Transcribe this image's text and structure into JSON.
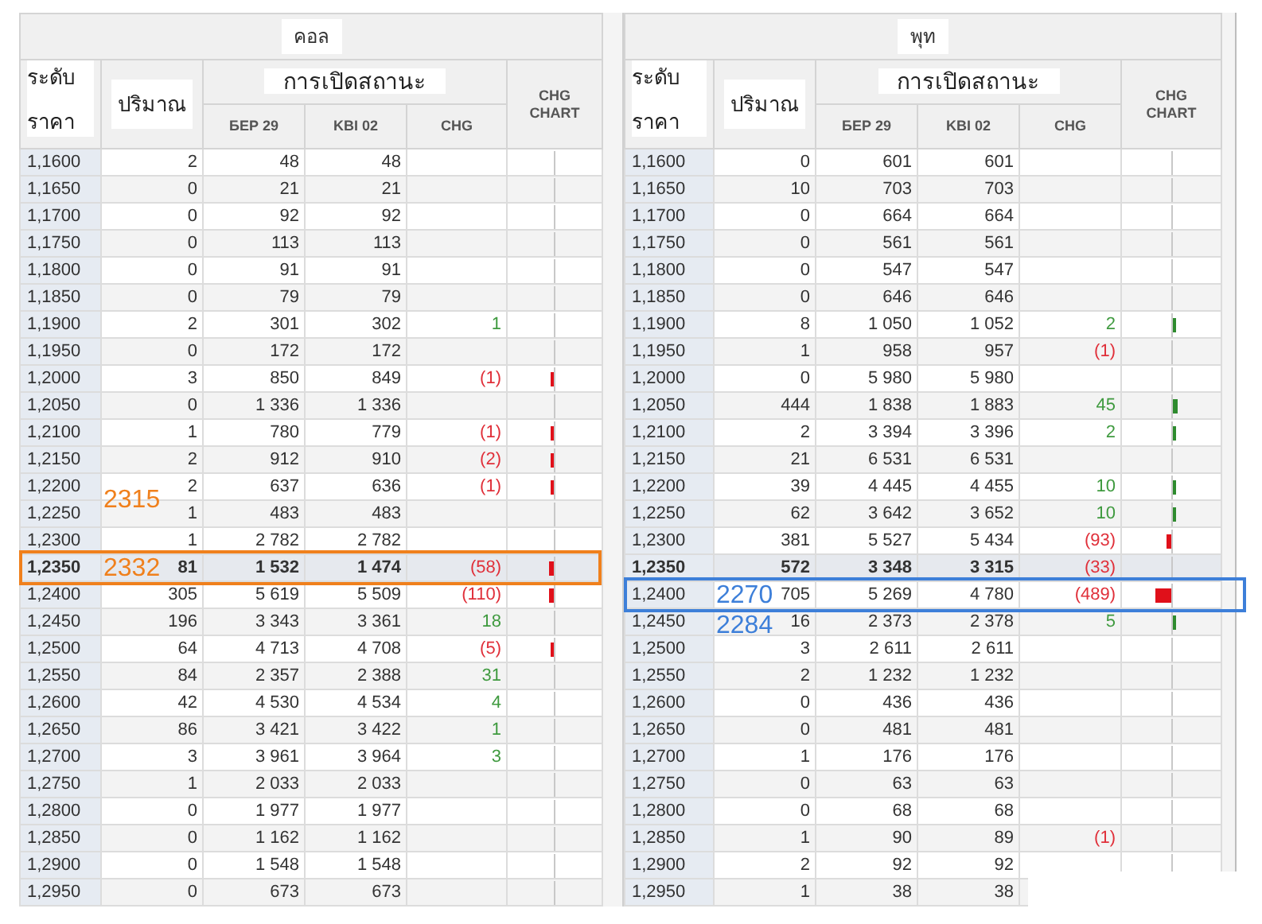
{
  "tables": [
    {
      "title": "คอล",
      "headers": {
        "price": [
          "ระดับ",
          "ราคา"
        ],
        "volume": "ปริมาณ",
        "open_interest": "การเปิดสถานะ",
        "columns": [
          "БЕР 29",
          "KBI 02",
          "CHG"
        ],
        "chart": [
          "CHG",
          "CHART"
        ]
      },
      "color": "#f0801c",
      "rows": [
        {
          "price": "1,1600",
          "volume": "2",
          "bep": "48",
          "kbi": "48",
          "selected": false,
          "boxed": false
        },
        {
          "price": "1,1650",
          "volume": "0",
          "bep": "21",
          "kbi": "21",
          "selected": false,
          "boxed": false
        },
        {
          "price": "1,1700",
          "volume": "0",
          "bep": "92",
          "kbi": "92",
          "selected": false,
          "boxed": false
        },
        {
          "price": "1,1750",
          "volume": "0",
          "bep": "113",
          "kbi": "113",
          "selected": false,
          "boxed": false
        },
        {
          "price": "1,1800",
          "volume": "0",
          "bep": "91",
          "kbi": "91",
          "selected": false,
          "boxed": false
        },
        {
          "price": "1,1850",
          "volume": "0",
          "bep": "79",
          "kbi": "79",
          "selected": false,
          "boxed": false
        },
        {
          "price": "1,1900",
          "volume": "2",
          "bep": "301",
          "kbi": "302",
          "chg": "1",
          "kind": "up",
          "selected": false,
          "boxed": false
        },
        {
          "price": "1,1950",
          "volume": "0",
          "bep": "172",
          "kbi": "172",
          "selected": false,
          "boxed": false
        },
        {
          "price": "1,2000",
          "volume": "3",
          "bep": "850",
          "kbi": "849",
          "chg": "(1)",
          "kind": "down",
          "bar": {
            "level": 0.07
          },
          "selected": false,
          "boxed": false
        },
        {
          "price": "1,2050",
          "volume": "0",
          "bep": "1 336",
          "kbi": "1 336",
          "selected": false,
          "boxed": false
        },
        {
          "price": "1,2100",
          "volume": "1",
          "bep": "780",
          "kbi": "779",
          "chg": "(1)",
          "kind": "down",
          "bar": {
            "level": 0.07
          },
          "selected": false,
          "boxed": false
        },
        {
          "price": "1,2150",
          "volume": "2",
          "bep": "912",
          "kbi": "910",
          "chg": "(2)",
          "kind": "down",
          "bar": {
            "level": 0.07
          },
          "selected": false,
          "boxed": false
        },
        {
          "price": "1,2200",
          "volume": "2",
          "bep": "637",
          "kbi": "636",
          "chg": "(1)",
          "kind": "down",
          "bar": {
            "level": 0.07
          },
          "note": "2315",
          "selected": false,
          "boxed": false
        },
        {
          "price": "1,2250",
          "volume": "1",
          "bep": "483",
          "kbi": "483",
          "selected": false,
          "boxed": false
        },
        {
          "price": "1,2300",
          "volume": "1",
          "bep": "2 782",
          "kbi": "2 782",
          "selected": false,
          "boxed": false
        },
        {
          "price": "1,2350",
          "volume": "81",
          "bep": "1 532",
          "kbi": "1 474",
          "chg": "(58)",
          "kind": "down",
          "bar": {
            "level": 0.1
          },
          "note": "2332",
          "selected": true,
          "boxed": true
        },
        {
          "price": "1,2400",
          "volume": "305",
          "bep": "5 619",
          "kbi": "5 509",
          "chg": "(110)",
          "kind": "down",
          "bar": {
            "level": 0.1
          },
          "selected": false,
          "boxed": false
        },
        {
          "price": "1,2450",
          "volume": "196",
          "bep": "3 343",
          "kbi": "3 361",
          "chg": "18",
          "kind": "up",
          "selected": false,
          "boxed": false
        },
        {
          "price": "1,2500",
          "volume": "64",
          "bep": "4 713",
          "kbi": "4 708",
          "chg": "(5)",
          "kind": "down",
          "bar": {
            "level": 0.07
          },
          "selected": false,
          "boxed": false
        },
        {
          "price": "1,2550",
          "volume": "84",
          "bep": "2 357",
          "kbi": "2 388",
          "chg": "31",
          "kind": "up",
          "selected": false,
          "boxed": false
        },
        {
          "price": "1,2600",
          "volume": "42",
          "bep": "4 530",
          "kbi": "4 534",
          "chg": "4",
          "kind": "up",
          "selected": false,
          "boxed": false
        },
        {
          "price": "1,2650",
          "volume": "86",
          "bep": "3 421",
          "kbi": "3 422",
          "chg": "1",
          "kind": "up",
          "selected": false,
          "boxed": false
        },
        {
          "price": "1,2700",
          "volume": "3",
          "bep": "3 961",
          "kbi": "3 964",
          "chg": "3",
          "kind": "up",
          "selected": false,
          "boxed": false
        },
        {
          "price": "1,2750",
          "volume": "1",
          "bep": "2 033",
          "kbi": "2 033",
          "selected": false,
          "boxed": false
        },
        {
          "price": "1,2800",
          "volume": "0",
          "bep": "1 977",
          "kbi": "1 977",
          "selected": false,
          "boxed": false
        },
        {
          "price": "1,2850",
          "volume": "0",
          "bep": "1 162",
          "kbi": "1 162",
          "selected": false,
          "boxed": false
        },
        {
          "price": "1,2900",
          "volume": "0",
          "bep": "1 548",
          "kbi": "1 548",
          "selected": false,
          "boxed": false
        },
        {
          "price": "1,2950",
          "volume": "0",
          "bep": "673",
          "kbi": "673",
          "selected": false,
          "boxed": false
        }
      ]
    },
    {
      "title": "พุท",
      "headers": {
        "price": [
          "ระดับ",
          "ราคา"
        ],
        "volume": "ปริมาณ",
        "open_interest": "การเปิดสถานะ",
        "columns": [
          "БЕР 29",
          "KBI 02",
          "CHG"
        ],
        "chart": [
          "CHG",
          "CHART"
        ]
      },
      "color": "#3d7fd9",
      "rows": [
        {
          "price": "1,1600",
          "volume": "0",
          "bep": "601",
          "kbi": "601",
          "selected": false,
          "boxed": false
        },
        {
          "price": "1,1650",
          "volume": "10",
          "bep": "703",
          "kbi": "703",
          "selected": false,
          "boxed": false
        },
        {
          "price": "1,1700",
          "volume": "0",
          "bep": "664",
          "kbi": "664",
          "selected": false,
          "boxed": false
        },
        {
          "price": "1,1750",
          "volume": "0",
          "bep": "561",
          "kbi": "561",
          "selected": false,
          "boxed": false
        },
        {
          "price": "1,1800",
          "volume": "0",
          "bep": "547",
          "kbi": "547",
          "selected": false,
          "boxed": false
        },
        {
          "price": "1,1850",
          "volume": "0",
          "bep": "646",
          "kbi": "646",
          "selected": false,
          "boxed": false
        },
        {
          "price": "1,1900",
          "volume": "8",
          "bep": "1 050",
          "kbi": "1 052",
          "chg": "2",
          "kind": "up",
          "bar": {
            "level": 0.07
          },
          "selected": false,
          "boxed": false
        },
        {
          "price": "1,1950",
          "volume": "1",
          "bep": "958",
          "kbi": "957",
          "chg": "(1)",
          "kind": "down",
          "selected": false,
          "boxed": false
        },
        {
          "price": "1,2000",
          "volume": "0",
          "bep": "5 980",
          "kbi": "5 980",
          "selected": false,
          "boxed": false
        },
        {
          "price": "1,2050",
          "volume": "444",
          "bep": "1 838",
          "kbi": "1 883",
          "chg": "45",
          "kind": "up",
          "bar": {
            "level": 0.1
          },
          "selected": false,
          "boxed": false
        },
        {
          "price": "1,2100",
          "volume": "2",
          "bep": "3 394",
          "kbi": "3 396",
          "chg": "2",
          "kind": "up",
          "bar": {
            "level": 0.07
          },
          "selected": false,
          "boxed": false
        },
        {
          "price": "1,2150",
          "volume": "21",
          "bep": "6 531",
          "kbi": "6 531",
          "selected": false,
          "boxed": false
        },
        {
          "price": "1,2200",
          "volume": "39",
          "bep": "4 445",
          "kbi": "4 455",
          "chg": "10",
          "kind": "up",
          "bar": {
            "level": 0.07
          },
          "selected": false,
          "boxed": false
        },
        {
          "price": "1,2250",
          "volume": "62",
          "bep": "3 642",
          "kbi": "3 652",
          "chg": "10",
          "kind": "up",
          "bar": {
            "level": 0.07
          },
          "selected": false,
          "boxed": false
        },
        {
          "price": "1,2300",
          "volume": "381",
          "bep": "5 527",
          "kbi": "5 434",
          "chg": "(93)",
          "kind": "down",
          "bar": {
            "level": 0.1
          },
          "selected": false,
          "boxed": false
        },
        {
          "price": "1,2350",
          "volume": "572",
          "bep": "3 348",
          "kbi": "3 315",
          "chg": "(33)",
          "kind": "down",
          "selected": true,
          "boxed": false
        },
        {
          "price": "1,2400",
          "volume": "705",
          "bep": "5 269",
          "kbi": "4 780",
          "chg": "(489)",
          "kind": "down",
          "bar": {
            "level": 0.33
          },
          "note": "2270",
          "selected": false,
          "boxed": true
        },
        {
          "price": "1,2450",
          "volume": "16",
          "bep": "2 373",
          "kbi": "2 378",
          "chg": "5",
          "kind": "up",
          "bar": {
            "level": 0.07
          },
          "note": "2284",
          "selected": false,
          "boxed": false
        },
        {
          "price": "1,2500",
          "volume": "3",
          "bep": "2 611",
          "kbi": "2 611",
          "selected": false,
          "boxed": false
        },
        {
          "price": "1,2550",
          "volume": "2",
          "bep": "1 232",
          "kbi": "1 232",
          "selected": false,
          "boxed": false
        },
        {
          "price": "1,2600",
          "volume": "0",
          "bep": "436",
          "kbi": "436",
          "selected": false,
          "boxed": false
        },
        {
          "price": "1,2650",
          "volume": "0",
          "bep": "481",
          "kbi": "481",
          "selected": false,
          "boxed": false
        },
        {
          "price": "1,2700",
          "volume": "1",
          "bep": "176",
          "kbi": "176",
          "selected": false,
          "boxed": false
        },
        {
          "price": "1,2750",
          "volume": "0",
          "bep": "63",
          "kbi": "63",
          "selected": false,
          "boxed": false
        },
        {
          "price": "1,2800",
          "volume": "0",
          "bep": "68",
          "kbi": "68",
          "selected": false,
          "boxed": false
        },
        {
          "price": "1,2850",
          "volume": "1",
          "bep": "90",
          "kbi": "89",
          "chg": "(1)",
          "kind": "down",
          "selected": false,
          "boxed": false
        },
        {
          "price": "1,2900",
          "volume": "2",
          "bep": "92",
          "kbi": "92",
          "selected": false,
          "boxed": false
        },
        {
          "price": "1,2950",
          "volume": "1",
          "bep": "38",
          "kbi": "38",
          "selected": false,
          "boxed": false
        }
      ]
    }
  ]
}
